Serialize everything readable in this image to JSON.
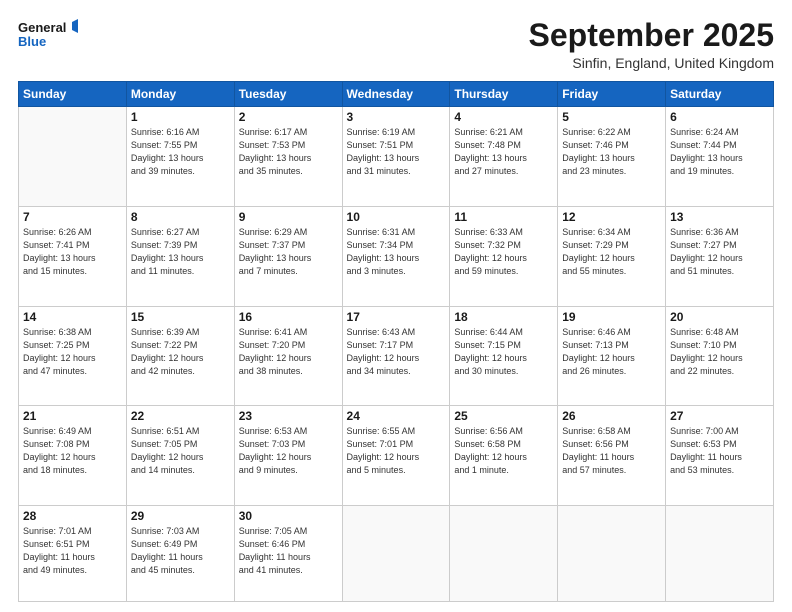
{
  "header": {
    "logo_line1": "General",
    "logo_line2": "Blue",
    "month": "September 2025",
    "location": "Sinfin, England, United Kingdom"
  },
  "weekdays": [
    "Sunday",
    "Monday",
    "Tuesday",
    "Wednesday",
    "Thursday",
    "Friday",
    "Saturday"
  ],
  "weeks": [
    [
      {
        "day": "",
        "info": ""
      },
      {
        "day": "1",
        "info": "Sunrise: 6:16 AM\nSunset: 7:55 PM\nDaylight: 13 hours\nand 39 minutes."
      },
      {
        "day": "2",
        "info": "Sunrise: 6:17 AM\nSunset: 7:53 PM\nDaylight: 13 hours\nand 35 minutes."
      },
      {
        "day": "3",
        "info": "Sunrise: 6:19 AM\nSunset: 7:51 PM\nDaylight: 13 hours\nand 31 minutes."
      },
      {
        "day": "4",
        "info": "Sunrise: 6:21 AM\nSunset: 7:48 PM\nDaylight: 13 hours\nand 27 minutes."
      },
      {
        "day": "5",
        "info": "Sunrise: 6:22 AM\nSunset: 7:46 PM\nDaylight: 13 hours\nand 23 minutes."
      },
      {
        "day": "6",
        "info": "Sunrise: 6:24 AM\nSunset: 7:44 PM\nDaylight: 13 hours\nand 19 minutes."
      }
    ],
    [
      {
        "day": "7",
        "info": "Sunrise: 6:26 AM\nSunset: 7:41 PM\nDaylight: 13 hours\nand 15 minutes."
      },
      {
        "day": "8",
        "info": "Sunrise: 6:27 AM\nSunset: 7:39 PM\nDaylight: 13 hours\nand 11 minutes."
      },
      {
        "day": "9",
        "info": "Sunrise: 6:29 AM\nSunset: 7:37 PM\nDaylight: 13 hours\nand 7 minutes."
      },
      {
        "day": "10",
        "info": "Sunrise: 6:31 AM\nSunset: 7:34 PM\nDaylight: 13 hours\nand 3 minutes."
      },
      {
        "day": "11",
        "info": "Sunrise: 6:33 AM\nSunset: 7:32 PM\nDaylight: 12 hours\nand 59 minutes."
      },
      {
        "day": "12",
        "info": "Sunrise: 6:34 AM\nSunset: 7:29 PM\nDaylight: 12 hours\nand 55 minutes."
      },
      {
        "day": "13",
        "info": "Sunrise: 6:36 AM\nSunset: 7:27 PM\nDaylight: 12 hours\nand 51 minutes."
      }
    ],
    [
      {
        "day": "14",
        "info": "Sunrise: 6:38 AM\nSunset: 7:25 PM\nDaylight: 12 hours\nand 47 minutes."
      },
      {
        "day": "15",
        "info": "Sunrise: 6:39 AM\nSunset: 7:22 PM\nDaylight: 12 hours\nand 42 minutes."
      },
      {
        "day": "16",
        "info": "Sunrise: 6:41 AM\nSunset: 7:20 PM\nDaylight: 12 hours\nand 38 minutes."
      },
      {
        "day": "17",
        "info": "Sunrise: 6:43 AM\nSunset: 7:17 PM\nDaylight: 12 hours\nand 34 minutes."
      },
      {
        "day": "18",
        "info": "Sunrise: 6:44 AM\nSunset: 7:15 PM\nDaylight: 12 hours\nand 30 minutes."
      },
      {
        "day": "19",
        "info": "Sunrise: 6:46 AM\nSunset: 7:13 PM\nDaylight: 12 hours\nand 26 minutes."
      },
      {
        "day": "20",
        "info": "Sunrise: 6:48 AM\nSunset: 7:10 PM\nDaylight: 12 hours\nand 22 minutes."
      }
    ],
    [
      {
        "day": "21",
        "info": "Sunrise: 6:49 AM\nSunset: 7:08 PM\nDaylight: 12 hours\nand 18 minutes."
      },
      {
        "day": "22",
        "info": "Sunrise: 6:51 AM\nSunset: 7:05 PM\nDaylight: 12 hours\nand 14 minutes."
      },
      {
        "day": "23",
        "info": "Sunrise: 6:53 AM\nSunset: 7:03 PM\nDaylight: 12 hours\nand 9 minutes."
      },
      {
        "day": "24",
        "info": "Sunrise: 6:55 AM\nSunset: 7:01 PM\nDaylight: 12 hours\nand 5 minutes."
      },
      {
        "day": "25",
        "info": "Sunrise: 6:56 AM\nSunset: 6:58 PM\nDaylight: 12 hours\nand 1 minute."
      },
      {
        "day": "26",
        "info": "Sunrise: 6:58 AM\nSunset: 6:56 PM\nDaylight: 11 hours\nand 57 minutes."
      },
      {
        "day": "27",
        "info": "Sunrise: 7:00 AM\nSunset: 6:53 PM\nDaylight: 11 hours\nand 53 minutes."
      }
    ],
    [
      {
        "day": "28",
        "info": "Sunrise: 7:01 AM\nSunset: 6:51 PM\nDaylight: 11 hours\nand 49 minutes."
      },
      {
        "day": "29",
        "info": "Sunrise: 7:03 AM\nSunset: 6:49 PM\nDaylight: 11 hours\nand 45 minutes."
      },
      {
        "day": "30",
        "info": "Sunrise: 7:05 AM\nSunset: 6:46 PM\nDaylight: 11 hours\nand 41 minutes."
      },
      {
        "day": "",
        "info": ""
      },
      {
        "day": "",
        "info": ""
      },
      {
        "day": "",
        "info": ""
      },
      {
        "day": "",
        "info": ""
      }
    ]
  ]
}
